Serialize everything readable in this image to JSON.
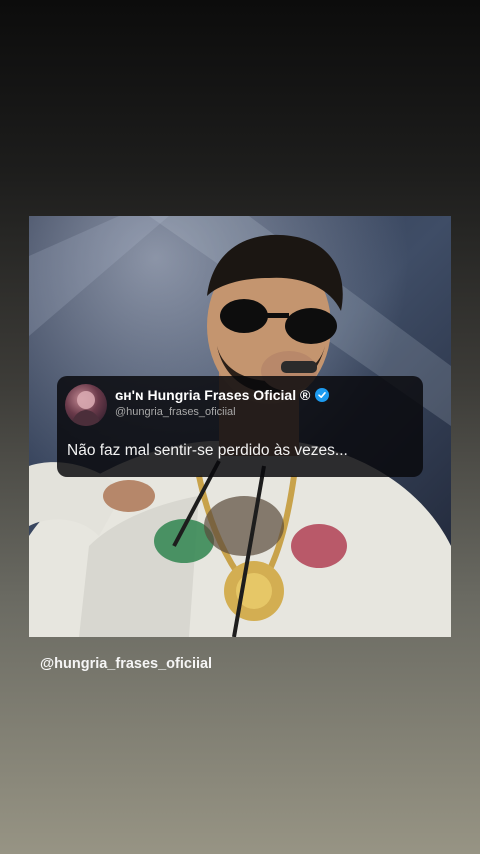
{
  "story": {
    "card": {
      "display_name": "ɢʜ'ɴ Hungria Frases Oficial ®",
      "handle": "@hungria_frases_oficiial",
      "verified_icon": "verified-badge-icon",
      "text": "Não faz mal sentir-se perdido às vezes..."
    },
    "footer_handle": "@hungria_frases_oficiial"
  },
  "colors": {
    "card_background": "#0a0a0e",
    "verified_badge": "#1d9bf0",
    "text_primary": "#ffffff",
    "text_secondary": "#a8a8a8"
  }
}
